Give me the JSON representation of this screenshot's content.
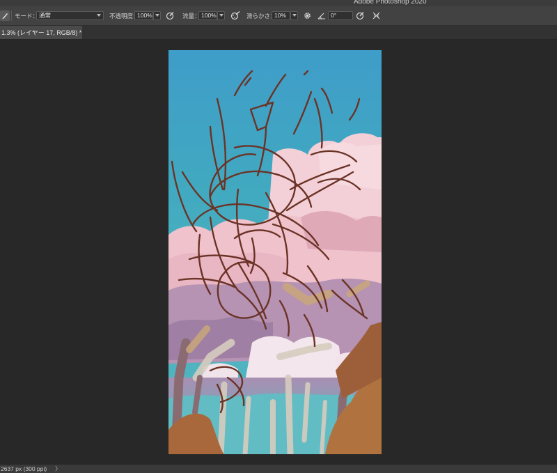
{
  "app": {
    "title": "Adobe Photoshop 2020"
  },
  "options_bar": {
    "mode_label": "モード：",
    "mode_value": "通常",
    "opacity_label": "不透明度：",
    "opacity_value": "100%",
    "flow_label": "流量：",
    "flow_value": "100%",
    "smoothing_label": "滑らかさ：",
    "smoothing_value": "10%",
    "angle_value": "0°"
  },
  "document_tab": {
    "label": "1.3% (レイヤー 17, RGB/8) *"
  },
  "status_bar": {
    "info": "2637 px (300 ppi)",
    "arrow": "〉"
  },
  "colors": {
    "sketch_stroke": "#6b3326",
    "sky_top": "#3f9cc8",
    "sky_mid": "#42adbb",
    "blossom_pink": "#f1c8cf",
    "trunk_brown": "#a8653a"
  }
}
